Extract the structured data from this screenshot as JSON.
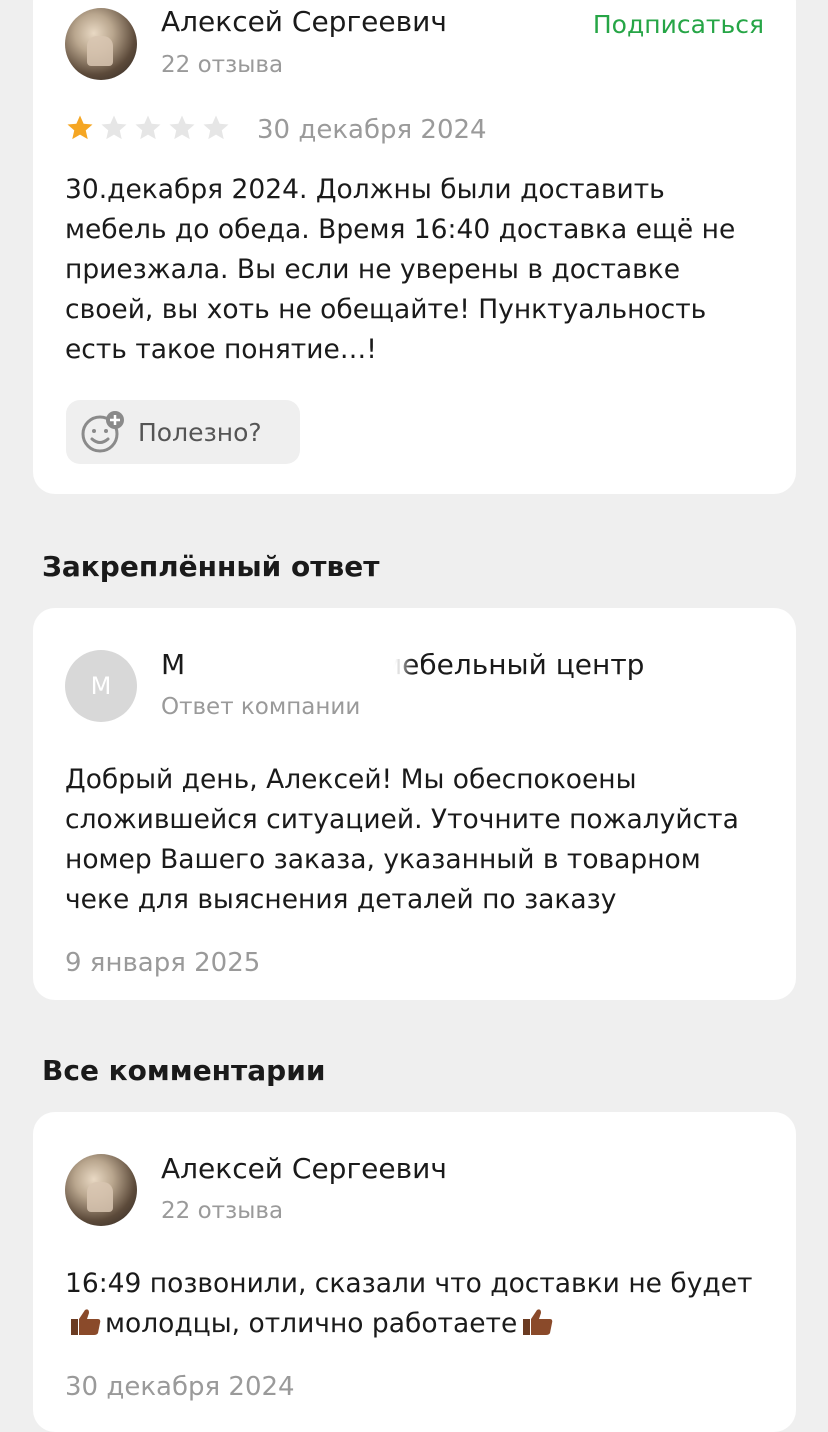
{
  "review": {
    "author_name": "Алексей Сергеевич",
    "author_reviews": "22 отзыва",
    "subscribe_label": "Подписаться",
    "rating": 1,
    "rating_max": 5,
    "date": "30 декабря 2024",
    "text": "30.декабря 2024. Должны были доставить мебель до обеда. Время 16:40 доставка ещё не приезжала. Вы если не уверены в доставке своей, вы хоть не обещайте! Пунктуальность есть такое понятие…!",
    "helpful_label": "Полезно?"
  },
  "pinned": {
    "section_title": "Закреплённый ответ",
    "avatar_letter": "М",
    "company_name_visible": "М",
    "company_name_suffix": ", мебельный центр",
    "role": "Ответ компании",
    "text": "Добрый день, Алексей! Мы обеспокоены сложившейся ситуацией. Уточните пожалуйста номер Вашего заказа, указанный в товарном чеке для выяснения деталей по заказу",
    "date": "9 января 2025"
  },
  "comments": {
    "section_title": "Все комментарии",
    "items": [
      {
        "author_name": "Алексей Сергеевич",
        "author_reviews": "22 отзыва",
        "text_part1": "16:49 позвонили, сказали что доставки не будет",
        "text_part2": "молодцы, отлично работаете",
        "date": "30 декабря 2024"
      }
    ]
  },
  "colors": {
    "accent_green": "#26a546",
    "star_filled": "#f5a623",
    "star_empty": "#e6e6e6",
    "muted_text": "#9a9a9a"
  }
}
